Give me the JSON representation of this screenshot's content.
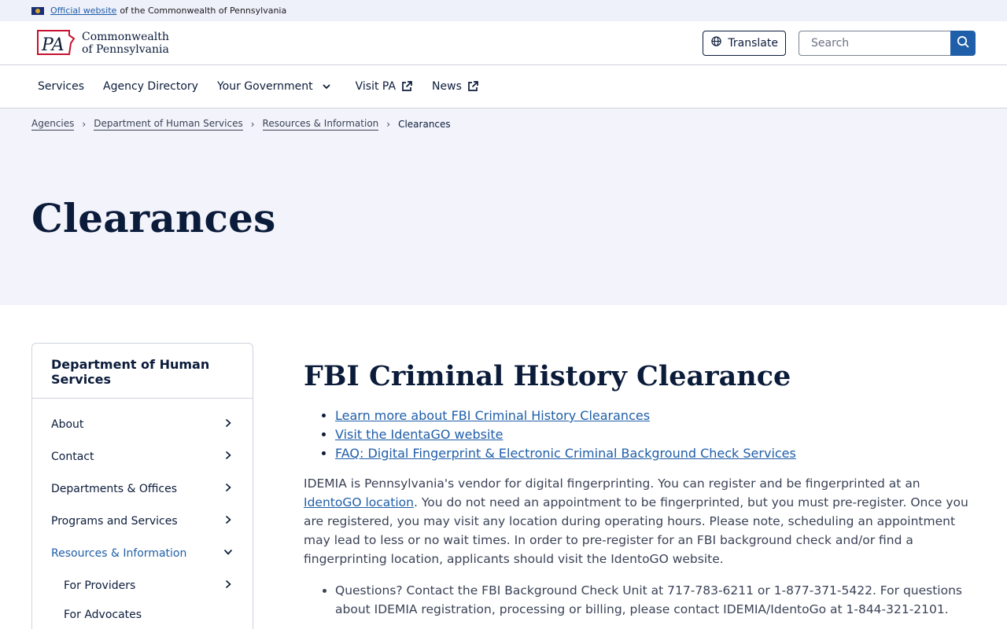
{
  "official_bar": {
    "link": "Official website",
    "text": "of the Commonwealth of Pennsylvania"
  },
  "header": {
    "logo_line1": "Commonwealth",
    "logo_line2": "of Pennsylvania",
    "logo_mark": "PA",
    "translate_label": "Translate",
    "search_placeholder": "Search"
  },
  "nav": {
    "items": [
      {
        "label": "Services"
      },
      {
        "label": "Agency Directory"
      },
      {
        "label": "Your Government"
      },
      {
        "label": "Visit PA"
      },
      {
        "label": "News"
      }
    ]
  },
  "breadcrumb": {
    "items": [
      "Agencies",
      "Department of Human Services",
      "Resources & Information"
    ],
    "current": "Clearances"
  },
  "page": {
    "title": "Clearances"
  },
  "sidebar": {
    "title": "Department of Human Services",
    "items": [
      {
        "label": "About"
      },
      {
        "label": "Contact"
      },
      {
        "label": "Departments & Offices"
      },
      {
        "label": "Programs and Services"
      },
      {
        "label": "Resources & Information"
      },
      {
        "label": "For Providers"
      },
      {
        "label": "For Advocates"
      }
    ]
  },
  "main": {
    "section_title": "FBI Criminal History Clearance",
    "links": [
      "Learn more about FBI Criminal History Clearances",
      "Visit the IdentaGO website",
      "FAQ: Digital Fingerprint & Electronic Criminal Background Check Services"
    ],
    "para_before_link": "IDEMIA is Pennsylvania's vendor for digital fingerprinting. You can register and be fingerprinted at an ",
    "para_link": "IdentoGO location",
    "para_after_link": ". You do not need an appointment to be fingerprinted, but you must pre-register. Once you are registered, you may visit any location during operating hours. Please note, scheduling an appointment may lead to less or no wait times. In order to pre-register for an FBI background check and/or find a fingerprinting location, applicants should visit the IdentoGO website.",
    "questions": "Questions? Contact the FBI Background Check Unit at 717-783-6211 or 1-877-371-5422. For questions about IDEMIA registration, processing or billing, please contact IDEMIA/IdentoGo at 1-844-321-2101."
  },
  "colors": {
    "navy": "#0b1b3a",
    "link_blue": "#1f5ea8",
    "hero_bg": "#f3f4fb",
    "banner_bg": "#eef0fa"
  },
  "icons": {
    "flag": "pa-flag-icon",
    "globe": "globe-icon",
    "search": "search-icon",
    "chevron_down": "chevron-down-icon",
    "chevron_right": "chevron-right-icon",
    "external": "external-link-icon"
  }
}
